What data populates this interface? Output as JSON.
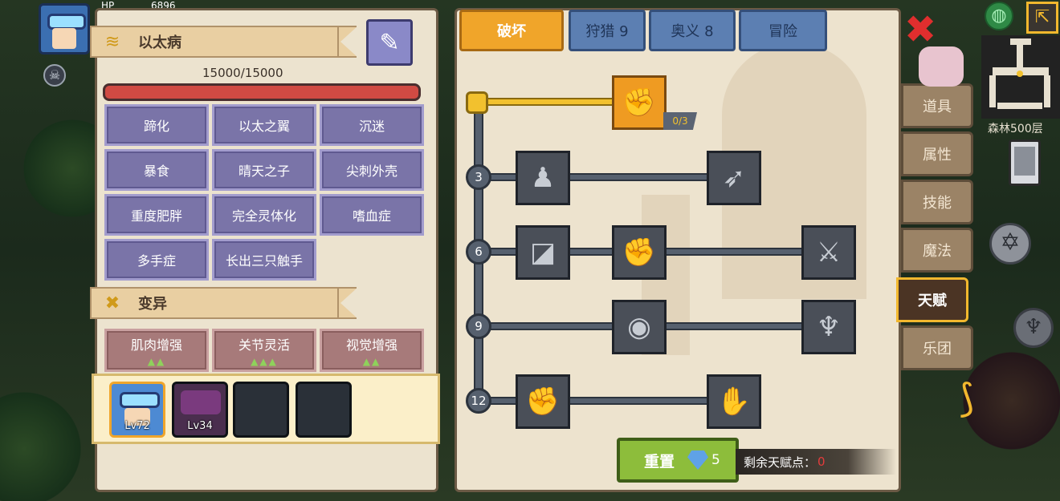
{
  "hud": {
    "hp_label": "HP",
    "hp_value": "6896",
    "avatar_icon": "player-avatar",
    "mask_icon": "mask-icon"
  },
  "left_panel": {
    "disease_section": {
      "title": "以太病",
      "emblem_icon": "wind-swirl-icon",
      "syringe_icon": "syringe-icon",
      "hp_text": "15000/15000",
      "hp_fraction": 1.0,
      "traits": [
        "蹄化",
        "以太之翼",
        "沉迷",
        "暴食",
        "晴天之子",
        "尖刺外壳",
        "重度肥胖",
        "完全灵体化",
        "嗜血症",
        "多手症",
        "长出三只触手"
      ]
    },
    "mutation_section": {
      "title": "变异",
      "emblem_icon": "dna-icon",
      "mutations": [
        {
          "label": "肌肉增强",
          "stars": "▲▲"
        },
        {
          "label": "关节灵活",
          "stars": "▲▲▲"
        },
        {
          "label": "视觉增强",
          "stars": "▲▲"
        }
      ]
    },
    "team": [
      {
        "level": "Lv72",
        "icon": "hero-portrait"
      },
      {
        "level": "Lv34",
        "icon": "pet-portrait"
      },
      {
        "level": "",
        "icon": "empty-slot"
      },
      {
        "level": "",
        "icon": "empty-slot"
      }
    ]
  },
  "talent_panel": {
    "tabs": [
      {
        "label": "破坏",
        "active": true
      },
      {
        "label": "狩猎 9",
        "active": false
      },
      {
        "label": "奥义 8",
        "active": false
      },
      {
        "label": "冒险",
        "active": false
      }
    ],
    "tree_levels": [
      "3",
      "6",
      "9",
      "12"
    ],
    "top_node": {
      "icon": "arm-wrestle-icon",
      "counter": "0/3"
    },
    "nodes": {
      "r3": [
        "muscle-body-icon",
        "arrow-shot-icon"
      ],
      "r6": [
        "shield-break-icon",
        "fist-strike-icon",
        "blade-splash-icon"
      ],
      "r9": [
        "ripple-icon",
        "bat-wings-icon"
      ],
      "r12": [
        "raised-fist-icon",
        "gauntlet-icon"
      ]
    },
    "reset": {
      "label": "重置",
      "gem_icon": "diamond-icon",
      "cost": "5"
    },
    "points": {
      "label": "剩余天赋点：",
      "value": "0"
    }
  },
  "side_tabs": [
    {
      "label": "道具",
      "active": false
    },
    {
      "label": "属性",
      "active": false
    },
    {
      "label": "技能",
      "active": false
    },
    {
      "label": "魔法",
      "active": false
    },
    {
      "label": "天赋",
      "active": true
    },
    {
      "label": "乐团",
      "active": false
    }
  ],
  "right_hud": {
    "close_icon": "close-icon",
    "globe_icon": "globe-icon",
    "exit_icon": "exit-icon",
    "floor_label": "森林500层",
    "phone_icon": "phone-icon",
    "hexagram_icon": "hexagram-icon",
    "trident_icon": "trident-icon",
    "bow_icon": "bow-icon"
  },
  "colors": {
    "accent_gold": "#f2b82e",
    "trait_purple": "#7a74a8",
    "mutation_rose": "#a77a7a",
    "hp_red": "#d04a43",
    "reset_green": "#8dbd3b"
  }
}
